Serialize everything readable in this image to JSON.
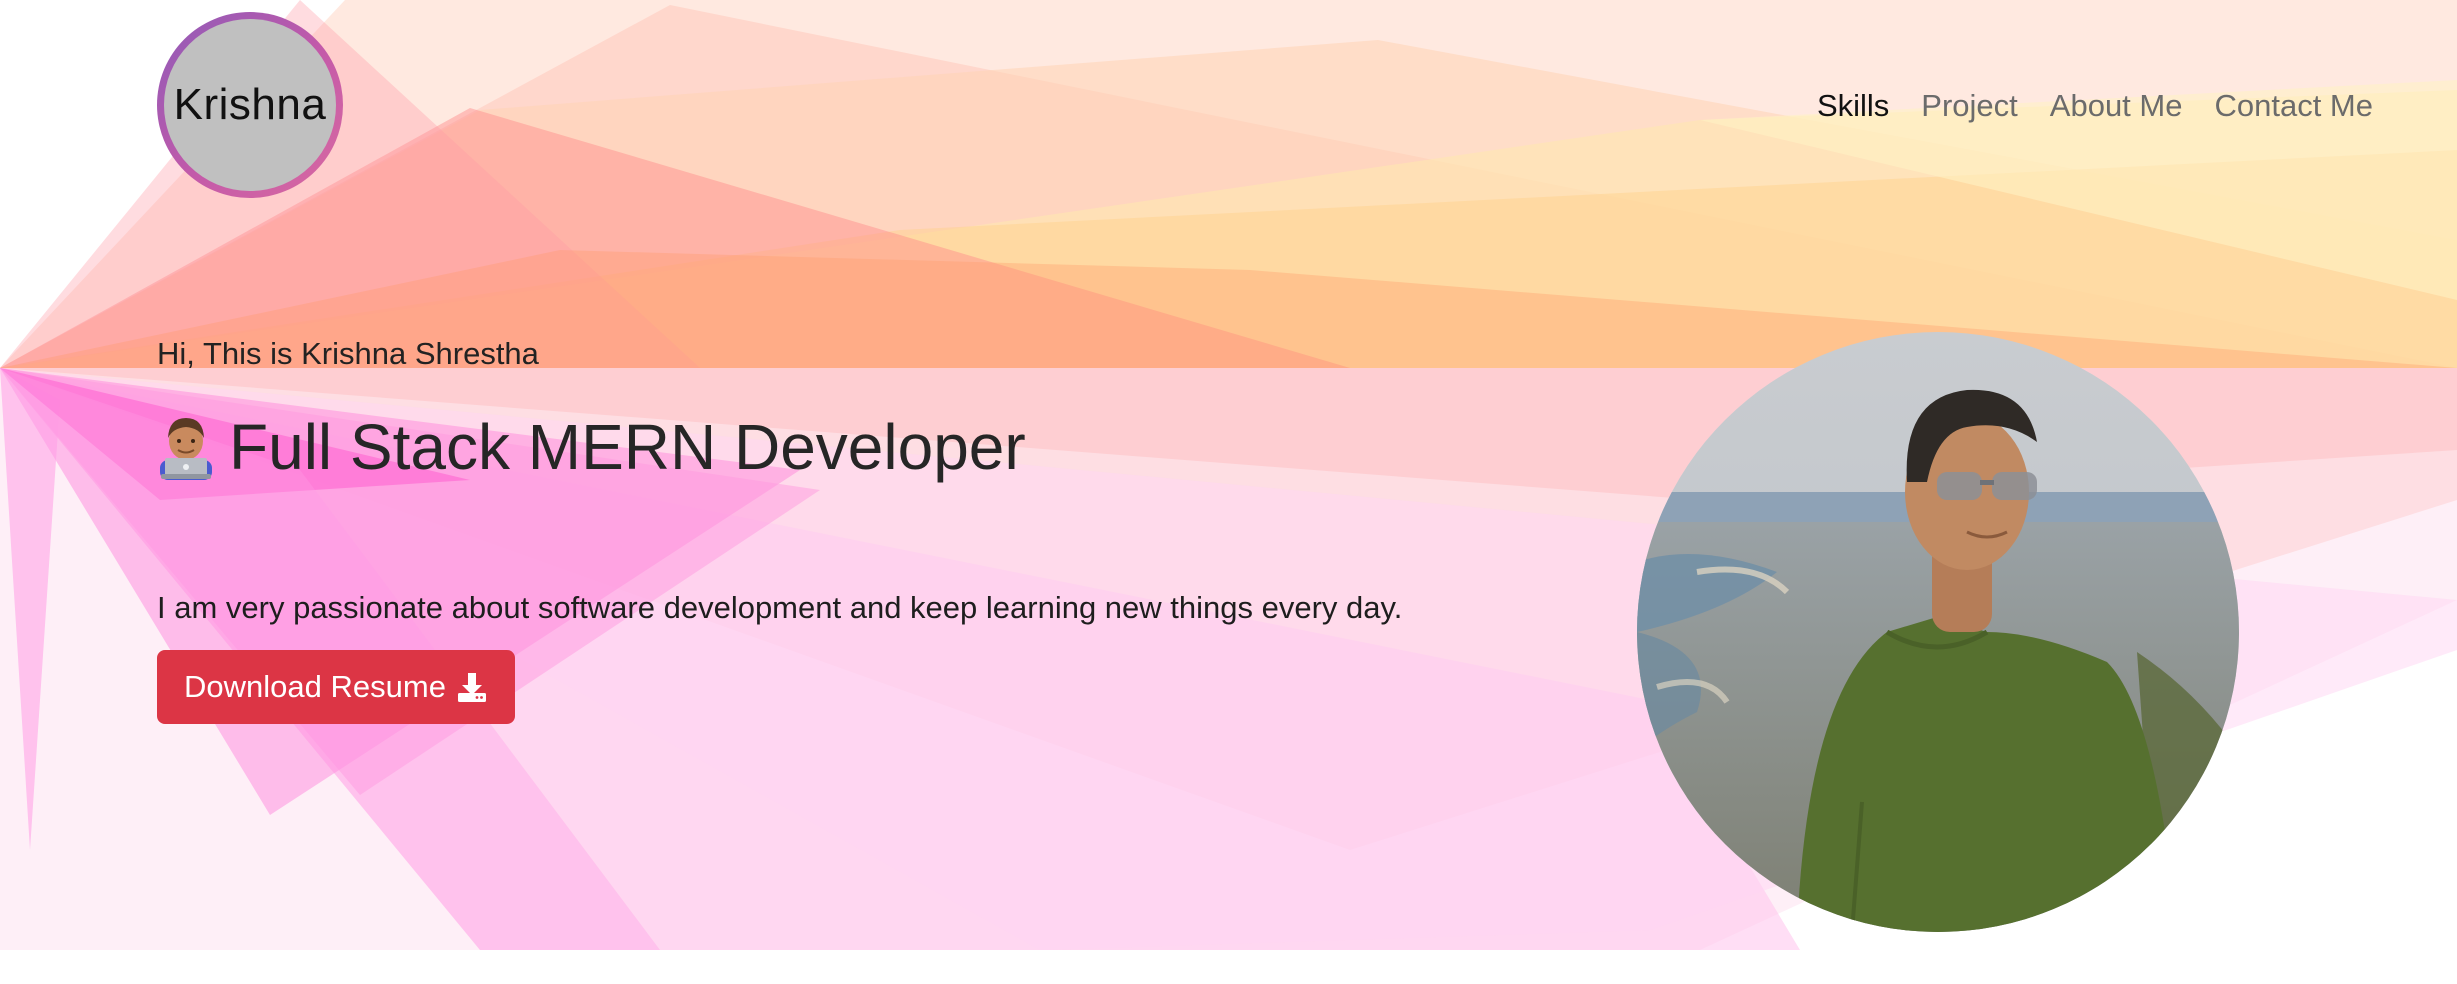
{
  "header": {
    "logo_text": "Krishna",
    "nav": [
      {
        "label": "Skills",
        "active": true
      },
      {
        "label": "Project",
        "active": false
      },
      {
        "label": "About Me",
        "active": false
      },
      {
        "label": "Contact Me",
        "active": false
      }
    ]
  },
  "hero": {
    "greeting": "Hi, This is Krishna Shrestha",
    "role": "Full Stack MERN Developer",
    "role_icon": "technologist-emoji-icon",
    "tagline": "I am very passionate about software development and keep learning new things every day.",
    "download_button": "Download Resume",
    "download_icon": "download-icon",
    "photo": "profile-photo"
  },
  "colors": {
    "button_red": "#dc3545",
    "logo_ring": "#b05aae",
    "logo_fill": "#c0c0c0",
    "nav_active": "#111111",
    "nav_inactive": "#6b6b6b"
  }
}
